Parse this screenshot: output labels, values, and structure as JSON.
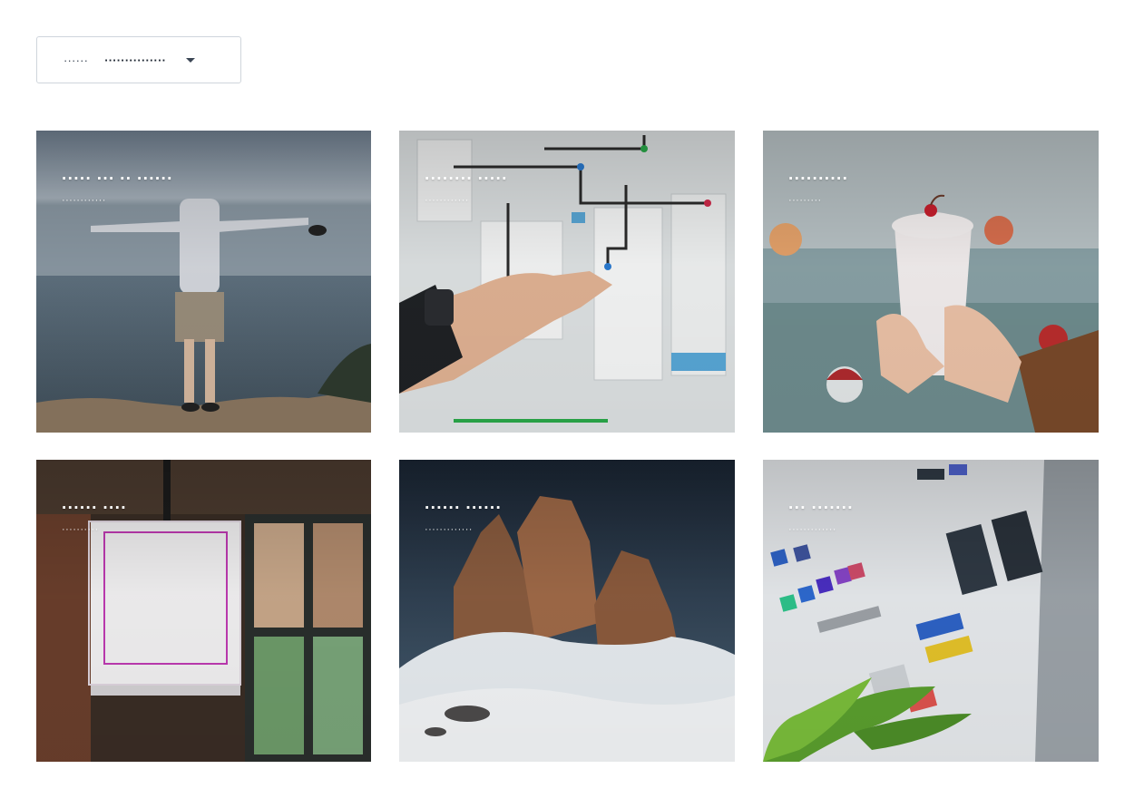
{
  "sort": {
    "label": "······",
    "value": "···············"
  },
  "cards": [
    {
      "title": "····· ··· ·· ······",
      "subtitle": "············"
    },
    {
      "title": "········ ·····",
      "subtitle": "············"
    },
    {
      "title": "··········",
      "subtitle": "·········"
    },
    {
      "title": "······ ····",
      "subtitle": "··········"
    },
    {
      "title": "······ ······",
      "subtitle": "·············"
    },
    {
      "title": "··· ·······",
      "subtitle": "·············"
    }
  ]
}
